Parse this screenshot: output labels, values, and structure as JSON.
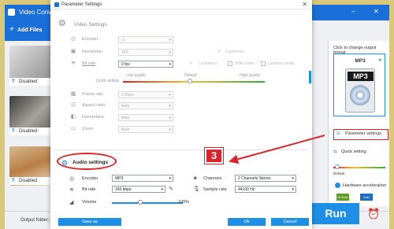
{
  "app": {
    "title": "Video Conve",
    "add_files": "Add Files",
    "disabled_label": "Disabled",
    "output_folder": "Output folder:",
    "run_label": "Run"
  },
  "right_panel": {
    "click_to": "Click to change output format",
    "format": "MP3",
    "format_icon_label": "MP3",
    "param_settings": "Parameter settings",
    "quick_setting": "Quick setting",
    "default": "Default",
    "hw_accel": "Hardware acceleration",
    "nvidia": "NVIDIA",
    "intel": "Intel"
  },
  "dialog": {
    "title": "Parameter Settings",
    "video": {
      "heading": "Video Settings",
      "encoder_label": "Encoder",
      "encoder_value": "-1",
      "resolution_label": "Resolution",
      "resolution_value": "1P5",
      "customize": "Customize",
      "bitrate_label": "Bit rate",
      "bitrate_value": "0 fps",
      "vbr": "VBR mode",
      "lossless": "Lossless mode",
      "low_quality": "Low quality",
      "default": "Default",
      "high_quality": "High quality",
      "quick_setting": "Quick setting",
      "framerate_label": "Frame rate",
      "framerate_value": "0 Kbps",
      "aspect_label": "Aspect ratio",
      "aspect_value": "Auto",
      "deinterlace_label": "Deinterlace",
      "deinterlace_value": "Auto",
      "zoom_label": "Zoom",
      "zoom_value": "Auto"
    },
    "audio": {
      "heading": "Audio settings",
      "encoder_label": "Encoder",
      "encoder_value": "MP3",
      "channels_label": "Channels",
      "channels_value": "2 Channels Stereo",
      "bitrate_label": "Bit rate",
      "bitrate_value": "160 kbps",
      "samplerate_label": "Sample rate",
      "samplerate_value": "44100 Hz",
      "volume_label": "Volume",
      "volume_value": "100%",
      "volume_level": 0.4
    },
    "save_as": "Save as",
    "ok": "Ok",
    "cancel": "Cancel"
  },
  "annotation": {
    "step_number": "3",
    "highlight_color": "#d9242a"
  }
}
